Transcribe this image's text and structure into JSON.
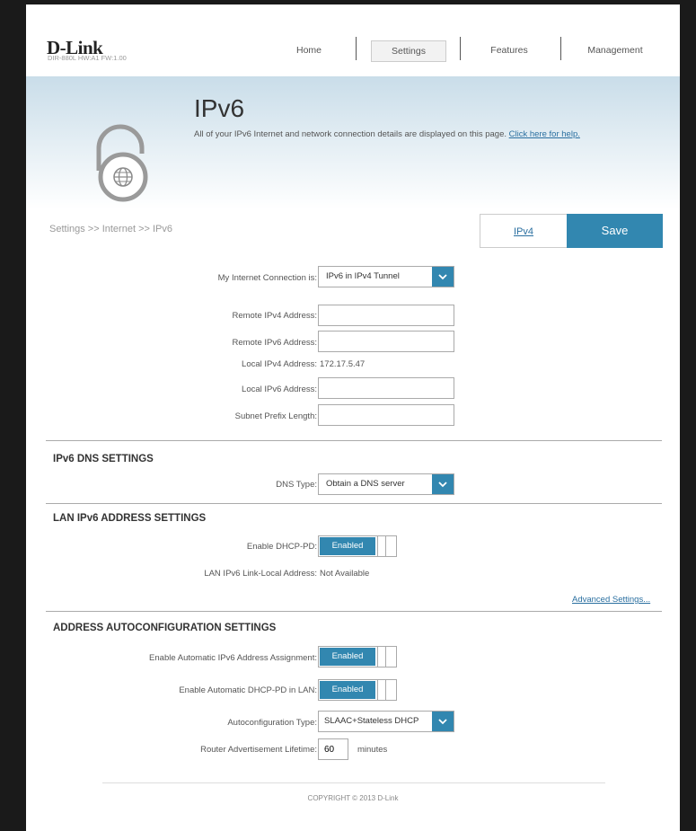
{
  "header": {
    "brand": "D-Link",
    "model_info": "DIR-880L   HW:A1   FW:1.00",
    "nav": [
      {
        "label": "Home",
        "active": false
      },
      {
        "label": "Settings",
        "active": true
      },
      {
        "label": "Features",
        "active": false
      },
      {
        "label": "Management",
        "active": false
      }
    ]
  },
  "banner": {
    "title": "IPv6",
    "description": "All of your IPv6 Internet and network connection details are displayed on this page.",
    "help_link": "Click here for help."
  },
  "breadcrumb": "Settings >> Internet >> IPv6",
  "actions": {
    "ipv4_tab": "IPv4",
    "save": "Save"
  },
  "connection": {
    "label": "My Internet Connection is:",
    "value": "IPv6 in IPv4 Tunnel",
    "remote_ipv4_label": "Remote IPv4 Address:",
    "remote_ipv4_value": "",
    "remote_ipv6_label": "Remote IPv6 Address:",
    "remote_ipv6_value": "",
    "local_ipv4_label": "Local IPv4 Address:",
    "local_ipv4_value": "172.17.5.47",
    "local_ipv6_label": "Local IPv6 Address:",
    "local_ipv6_value": "",
    "subnet_prefix_label": "Subnet Prefix Length:",
    "subnet_prefix_value": ""
  },
  "dns": {
    "section_title": "IPv6 DNS SETTINGS",
    "type_label": "DNS Type:",
    "type_value": "Obtain a DNS server"
  },
  "lan": {
    "section_title": "LAN IPv6 ADDRESS SETTINGS",
    "dhcp_pd_label": "Enable DHCP-PD:",
    "dhcp_pd_value": "Enabled",
    "link_local_label": "LAN IPv6 Link-Local Address:",
    "link_local_value": "Not Available",
    "advanced": "Advanced Settings..."
  },
  "autoconfig": {
    "section_title": "ADDRESS AUTOCONFIGURATION SETTINGS",
    "auto_assign_label": "Enable Automatic IPv6 Address Assignment:",
    "auto_assign_value": "Enabled",
    "auto_dhcp_pd_label": "Enable Automatic DHCP-PD in LAN:",
    "auto_dhcp_pd_value": "Enabled",
    "type_label": "Autoconfiguration Type:",
    "type_value": "SLAAC+Stateless DHCP",
    "lifetime_label": "Router Advertisement Lifetime:",
    "lifetime_value": "60",
    "lifetime_unit": "minutes"
  },
  "footer": {
    "copyright": "COPYRIGHT © 2013 D-Link"
  },
  "colors": {
    "accent": "#3287b0",
    "link": "#2a6fa0",
    "frame": "#1a1a1a"
  }
}
